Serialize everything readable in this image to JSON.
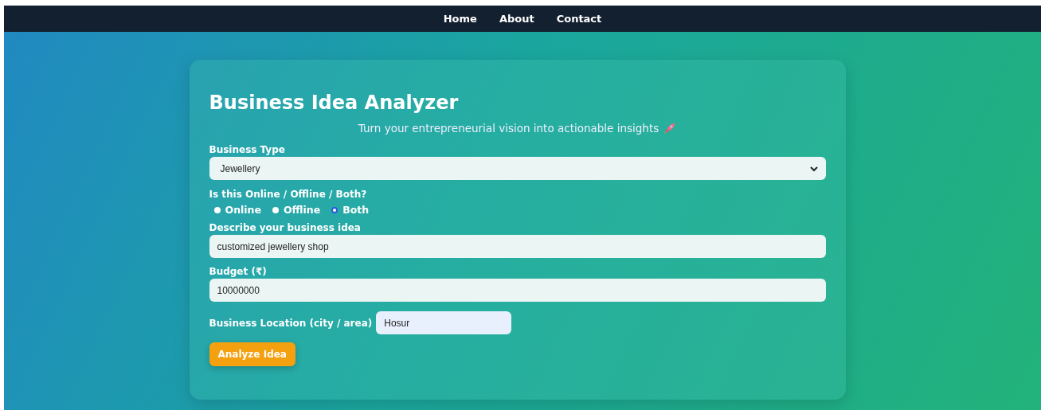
{
  "nav": {
    "links": [
      "Home",
      "About",
      "Contact"
    ]
  },
  "form": {
    "title": "Business Idea Analyzer",
    "subtitle": "Turn your entrepreneurial vision into actionable insights",
    "business_type": {
      "label": "Business Type",
      "value": "Jewellery"
    },
    "mode": {
      "label": "Is this Online / Offline / Both?",
      "options": [
        {
          "label": "Online",
          "selected": false
        },
        {
          "label": "Offline",
          "selected": false
        },
        {
          "label": "Both",
          "selected": true
        }
      ]
    },
    "idea": {
      "label": "Describe your business idea",
      "value": "customized jewellery shop"
    },
    "budget": {
      "label": "Budget (₹)",
      "value": "10000000"
    },
    "location": {
      "label": "Business Location (city / area)",
      "value": "Hosur"
    },
    "button": "Analyze Idea"
  }
}
